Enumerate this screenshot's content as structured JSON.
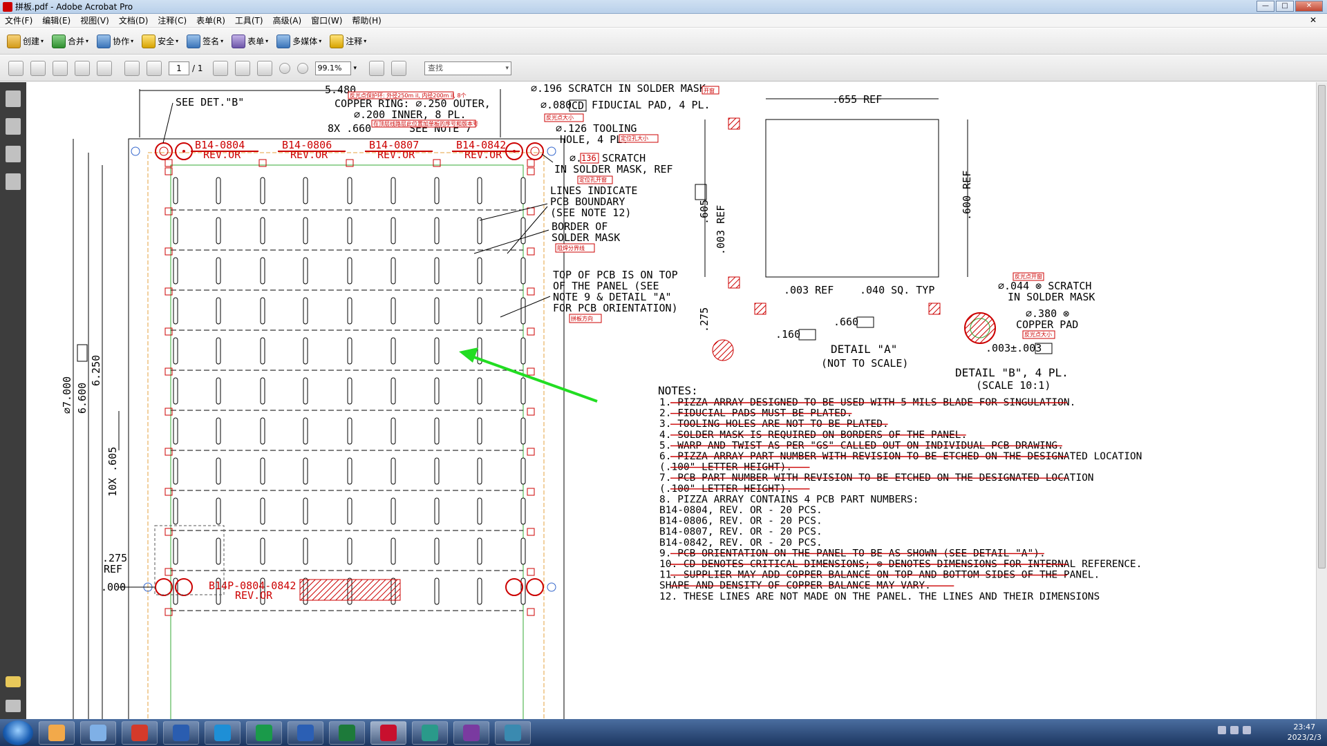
{
  "window": {
    "title": "拼板.pdf - Adobe Acrobat Pro"
  },
  "menu": [
    "文件(F)",
    "编辑(E)",
    "视图(V)",
    "文档(D)",
    "注释(C)",
    "表单(R)",
    "工具(T)",
    "高级(A)",
    "窗口(W)",
    "帮助(H)"
  ],
  "toolbar1": [
    "创建",
    "合并",
    "协作",
    "安全",
    "签名",
    "表单",
    "多媒体",
    "注释"
  ],
  "toolbar2": {
    "page_current": "1",
    "page_total": "/ 1",
    "zoom": "99.1%",
    "find_placeholder": "查找"
  },
  "drawing": {
    "top_dim": "5.480",
    "see_det_b": "SEE DET.\"B\"",
    "copper_ring_1": "COPPER RING: ⌀.250 OUTER,",
    "copper_ring_2": "⌀.200 INNER, 8 PL.",
    "pitch": "8X .660",
    "see_note": "SEE NOTE 7",
    "parts": [
      {
        "pn": "B14-0804",
        "rev": "REV.OR"
      },
      {
        "pn": "B14-0806",
        "rev": "REV.OR"
      },
      {
        "pn": "B14-0807",
        "rev": "REV.OR"
      },
      {
        "pn": "B14-0842",
        "rev": "REV.OR"
      }
    ],
    "bottom_part": "B14P-0804-0842",
    "bottom_rev": "REV.OR",
    "scratch_196": "⌀.196 SCRATCH IN SOLDER MASK",
    "fiducial": "⌀.080",
    "fiducial_cd": "CD",
    "fiducial_text": "FIDUCIAL PAD, 4 PL.",
    "tooling_1": "⌀.126 TOOLING",
    "tooling_2": "HOLE, 4 PL.",
    "scratch_136_pre": "⌀.",
    "scratch_136_val": "136",
    "scratch_136_post": "SCRATCH",
    "scratch_136_line2": "IN SOLDER MASK, REF",
    "lines_1": "LINES INDICATE",
    "lines_2": "PCB BOUNDARY",
    "lines_3": "(SEE NOTE 12)",
    "border_1": "BORDER OF",
    "border_2": "SOLDER MASK",
    "top_1": "TOP OF PCB IS ON TOP",
    "top_2": "OF THE PANEL (SEE",
    "top_3": "NOTE 9 & DETAIL \"A\"",
    "top_4": "FOR PCB ORIENTATION)",
    "dim_7000": "⌀7.000",
    "dim_6600": "6.600",
    "dim_6250": "6.250",
    "dim_605": "10X .605",
    "dim_275": ".275",
    "dim_ref": "REF",
    "dim_000": ".000",
    "det_a_655": ".655 REF",
    "det_a_600": ".600 REF",
    "det_a_605": ".605",
    "det_a_003v": ".003 REF",
    "det_a_003h": ".003 REF",
    "det_a_040": ".040 SQ. TYP",
    "det_a_660": ".660",
    "det_a_275": ".275",
    "det_a_160": ".160",
    "det_a_title": "DETAIL \"A\"",
    "det_a_sub": "(NOT TO SCALE)",
    "det_b_044": "⌀.044 ⊗ SCRATCH",
    "det_b_044b": "IN SOLDER MASK",
    "det_b_380": "⌀.380 ⊗",
    "det_b_pad": "COPPER PAD",
    "det_b_003": ".003±.003",
    "det_b_title": "DETAIL \"B\", 4 PL.",
    "det_b_sub": "(SCALE 10:1)",
    "annot": {
      "a1": "反光点保护环: 外径250m il, 内径200m il, 8个",
      "a2": "在顶层线路层此位置加单板的序号和版本号",
      "a3": "开窗",
      "a4": "反光点大小",
      "a5": "定位孔大小",
      "a6": "定位孔开窗",
      "a7": "阻焊分界线",
      "a8": "拼板方向",
      "a9": "反光点开窗",
      "a10": "反光点大小"
    },
    "notes_title": "NOTES:",
    "notes": [
      "1. PIZZA ARRAY DESIGNED TO BE USED WITH 5 MILS BLADE FOR SINGULATION.",
      "2. FIDUCIAL PADS MUST BE PLATED.",
      "3. TOOLING HOLES ARE NOT TO BE PLATED.",
      "4. SOLDER MASK IS REQUIRED ON BORDERS OF THE PANEL.",
      "5. WARP AND TWIST AS PER \"GS\" CALLED OUT ON INDIVIDUAL PCB DRAWING.",
      "6. PIZZA ARRAY PART NUMBER WITH REVISION TO BE ETCHED ON THE DESIGNATED LOCATION",
      "   (.100\" LETTER HEIGHT).",
      "7. PCB PART NUMBER WITH REVISION TO BE ETCHED ON THE DESIGNATED LOCATION",
      "   (.100\" LETTER HEIGHT).",
      "8. PIZZA ARRAY CONTAINS 4 PCB PART NUMBERS:",
      "   B14-0804, REV. OR - 20 PCS.",
      "   B14-0806, REV. OR - 20 PCS.",
      "   B14-0807, REV. OR - 20 PCS.",
      "   B14-0842, REV. OR - 20 PCS.",
      "9. PCB ORIENTATION ON THE PANEL TO BE AS SHOWN (SEE DETAIL \"A\").",
      "10. CD DENOTES CRITICAL DIMENSIONS; ⊗ DENOTES DIMENSIONS FOR INTERNAL REFERENCE.",
      "11. SUPPLIER MAY ADD COPPER BALANCE ON TOP AND BOTTOM SIDES OF THE PANEL.",
      "    SHAPE AND DENSITY OF COPPER BALANCE MAY VARY.",
      "12. THESE LINES ARE NOT MADE ON THE PANEL. THE LINES AND THEIR DIMENSIONS"
    ]
  },
  "taskbar": {
    "time": "23:47",
    "date": "2023/2/3"
  },
  "colors": {
    "accent_red": "#cc0000",
    "accent_green": "#22dd22",
    "board_green": "#33aa33",
    "board_orange": "#e6a23c"
  }
}
